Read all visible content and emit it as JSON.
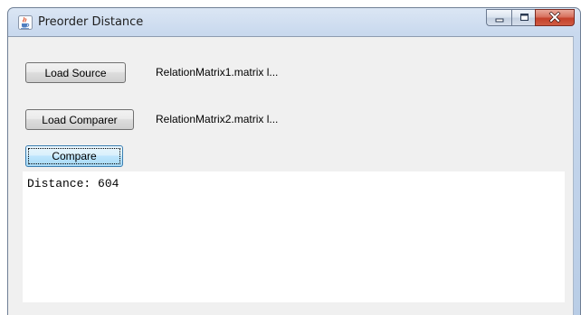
{
  "window": {
    "title": "Preorder Distance"
  },
  "buttons": {
    "load_source": "Load Source",
    "load_comparer": "Load Comparer",
    "compare": "Compare"
  },
  "files": {
    "source": "RelationMatrix1.matrix l...",
    "comparer": "RelationMatrix2.matrix l..."
  },
  "output": {
    "text": "Distance: 604"
  },
  "icons": {
    "app": "java-coffee-cup-icon",
    "minimize": "minimize-icon",
    "maximize": "maximize-icon",
    "close": "close-icon"
  },
  "colors": {
    "title_bar": "#c9d9ee",
    "client_bg": "#f0f0f0",
    "close_button": "#c4412a",
    "focused_button_border": "#3c7fb1"
  }
}
